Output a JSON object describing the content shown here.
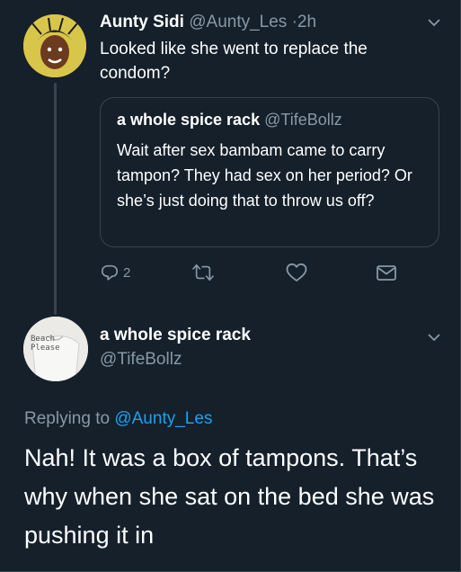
{
  "tweet": {
    "author_name": "Aunty Sidi",
    "author_handle": "@Aunty_Les",
    "separator": "·",
    "time": "2h",
    "text": "Looked like she went to replace the condom?",
    "quoted": {
      "author_name": "a whole spice rack",
      "author_handle": "@TifeBollz",
      "text": "Wait after sex bambam came to carry tampon? They had sex on her period? Or she’s just doing that to throw us off?"
    },
    "actions": [
      {
        "icon": "reply-icon",
        "count": "2"
      },
      {
        "icon": "retweet-icon",
        "count": ""
      },
      {
        "icon": "like-icon",
        "count": ""
      },
      {
        "icon": "share-icon",
        "count": ""
      }
    ]
  },
  "reply": {
    "author_name": "a whole spice rack",
    "author_handle": "@TifeBollz",
    "avatar_text": "Beach\nPlease",
    "replying_prefix": "Replying to",
    "replying_to": "@Aunty_Les",
    "text": "Nah! It was a box of tampons. That’s why when she sat on the bed she was pushing it in"
  },
  "colors": {
    "background": "#15202b",
    "secondary_text": "#8899a6",
    "accent": "#1da1f2",
    "border": "#38444d"
  }
}
